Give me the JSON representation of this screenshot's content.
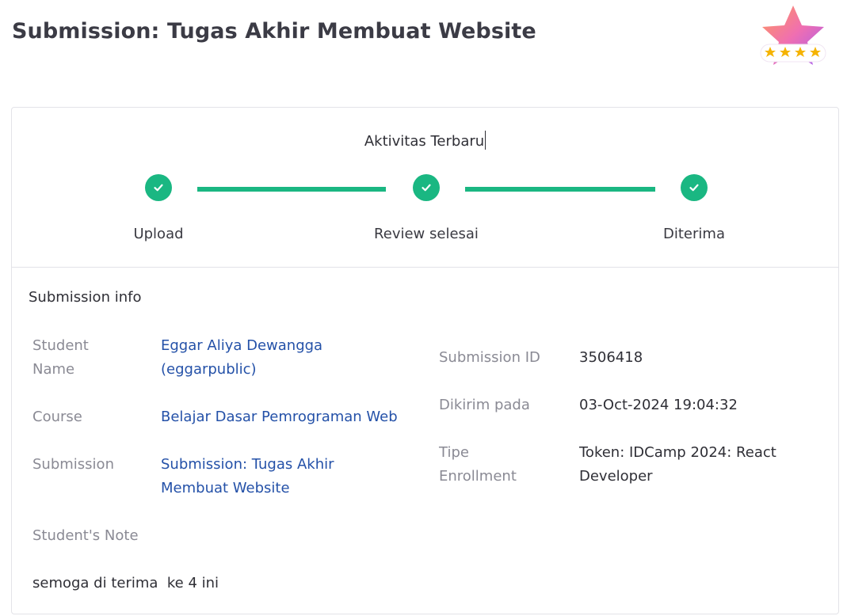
{
  "page": {
    "title": "Submission: Tugas Akhir Membuat Website"
  },
  "badge": {
    "icon": "star-rating-badge-icon",
    "rating": 4,
    "max_rating": 4
  },
  "activity": {
    "title": "Aktivitas Terbaru",
    "accent_color": "#1ab782",
    "steps": [
      {
        "label": "Upload",
        "status": "done",
        "icon": "check-icon"
      },
      {
        "label": "Review selesai",
        "status": "done",
        "icon": "check-icon"
      },
      {
        "label": "Diterima",
        "status": "done",
        "icon": "check-icon"
      }
    ]
  },
  "info": {
    "title": "Submission info",
    "student_name": {
      "label": "Student Name",
      "value": "Eggar Aliya Dewangga (eggarpublic)"
    },
    "course": {
      "label": "Course",
      "value": "Belajar Dasar Pemrograman Web"
    },
    "submission": {
      "label": "Submission",
      "value": "Submission: Tugas Akhir Membuat Website"
    },
    "submission_id": {
      "label": "Submission ID",
      "value": "3506418"
    },
    "sent_at": {
      "label": "Dikirim pada",
      "value": "03-Oct-2024 19:04:32"
    },
    "enrollment_type": {
      "label": "Tipe Enrollment",
      "value": "Token: IDCamp 2024: React Developer"
    },
    "student_note": {
      "label": "Student's Note",
      "value": "semoga di terima  ke 4 ini"
    },
    "link_color": "#2451a8"
  }
}
